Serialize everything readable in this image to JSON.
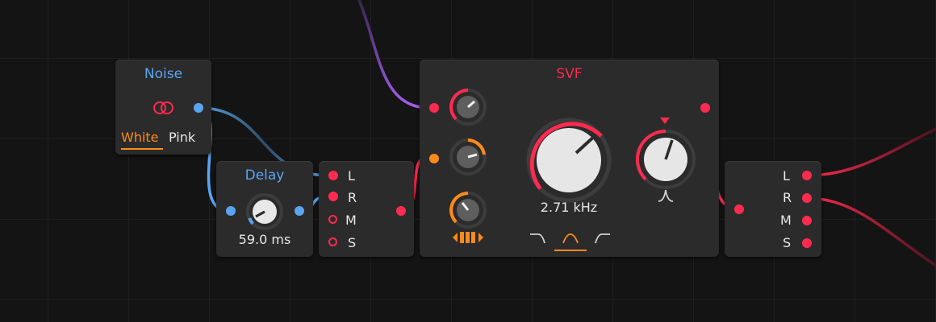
{
  "noise": {
    "title": "Noise",
    "mode_white": "White",
    "mode_pink": "Pink",
    "selected_mode": "White"
  },
  "delay": {
    "title": "Delay",
    "time_value": "59.0 ms"
  },
  "midside": {
    "ports": [
      "L",
      "R",
      "M",
      "S"
    ]
  },
  "svf": {
    "title": "SVF",
    "cutoff_value": "2.71 kHz",
    "filter_modes": [
      "lowpass",
      "bandpass",
      "highpass"
    ],
    "selected_filter": "bandpass"
  },
  "output": {
    "ports": [
      "L",
      "R",
      "M",
      "S"
    ]
  },
  "colors": {
    "accent_red": "#ff2a4f",
    "accent_blue": "#5aa5f0",
    "accent_orange": "#ff8a1a",
    "accent_purple": "#9b59e0",
    "panel": "#2b2b2b",
    "background": "#141414"
  }
}
